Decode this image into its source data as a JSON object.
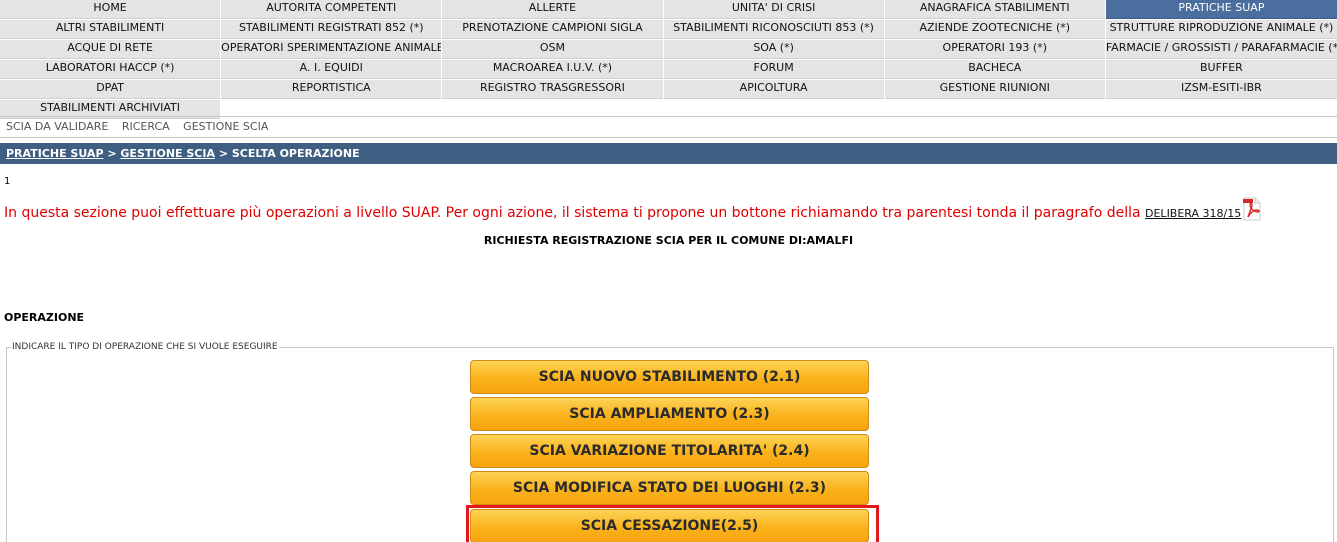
{
  "menu": {
    "rows": [
      [
        "HOME",
        "AUTORITA COMPETENTI",
        "ALLERTE",
        "UNITA' DI CRISI",
        "ANAGRAFICA STABILIMENTI",
        "PRATICHE SUAP"
      ],
      [
        "ALTRI STABILIMENTI",
        "STABILIMENTI REGISTRATI 852 (*)",
        "PRENOTAZIONE CAMPIONI SIGLA",
        "STABILIMENTI RICONOSCIUTI 853 (*)",
        "AZIENDE ZOOTECNICHE (*)",
        "STRUTTURE RIPRODUZIONE ANIMALE (*)"
      ],
      [
        "ACQUE DI RETE",
        "OPERATORI SPERIMENTAZIONE ANIMALE",
        "OSM",
        "SOA (*)",
        "OPERATORI 193 (*)",
        "FARMACIE / GROSSISTI / PARAFARMACIE (*)"
      ],
      [
        "LABORATORI HACCP (*)",
        "A. I. EQUIDI",
        "MACROAREA I.U.V. (*)",
        "FORUM",
        "BACHECA",
        "BUFFER"
      ],
      [
        "DPAT",
        "REPORTISTICA",
        "REGISTRO TRASGRESSORI",
        "APICOLTURA",
        "GESTIONE RIUNIONI",
        "IZSM-ESITI-IBR"
      ],
      [
        "STABILIMENTI ARCHIVIATI",
        "",
        "",
        "",
        "",
        ""
      ]
    ]
  },
  "subnav": [
    "SCIA DA VALIDARE",
    "RICERCA",
    "GESTIONE SCIA"
  ],
  "breadcrumb": {
    "link1": "PRATICHE SUAP",
    "sep1": " > ",
    "link2": "GESTIONE SCIA",
    "sep2": " > ",
    "current": "SCELTA OPERAZIONE"
  },
  "counter": "1",
  "intro": {
    "text": "In questa sezione puoi effettuare più operazioni a livello SUAP. Per ogni azione, il sistema ti propone un bottone richiamando tra parentesi tonda il paragrafo della ",
    "link": "DELIBERA 318/15"
  },
  "request_title": "RICHIESTA REGISTRAZIONE SCIA PER IL COMUNE DI:AMALFI",
  "operation_title": "OPERAZIONE",
  "legend": "INDICARE IL TIPO DI OPERAZIONE CHE SI VUOLE ESEGUIRE",
  "buttons": [
    "SCIA NUOVO STABILIMENTO (2.1)",
    "SCIA AMPLIAMENTO (2.3)",
    "SCIA VARIAZIONE TITOLARITA' (2.4)",
    "SCIA MODIFICA STATO DEI LUOGHI (2.3)",
    "SCIA CESSAZIONE(2.5)"
  ],
  "colors": {
    "active_tab": "#4a6e9e",
    "breadcrumb_bar": "#3f5f82",
    "intro_text": "#e00000",
    "button": "#f9b21b",
    "highlight": "#e1171b"
  },
  "icons": {
    "delibera": "pdf-icon"
  }
}
